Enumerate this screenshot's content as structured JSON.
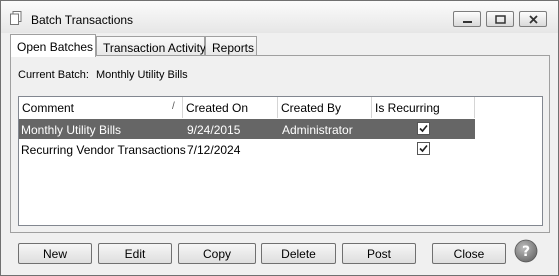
{
  "window": {
    "title": "Batch Transactions"
  },
  "tabs": [
    {
      "label": "Open Batches"
    },
    {
      "label": "Transaction Activity"
    },
    {
      "label": "Reports"
    }
  ],
  "current_batch": {
    "label": "Current Batch:",
    "value": "Monthly Utility Bills"
  },
  "grid": {
    "columns": [
      "Comment",
      "Created On",
      "Created By",
      "Is Recurring"
    ],
    "rows": [
      {
        "comment": "Monthly Utility Bills",
        "created_on": "9/24/2015",
        "created_by": "Administrator",
        "is_recurring": true,
        "selected": true
      },
      {
        "comment": "Recurring Vendor Transactions",
        "created_on": "7/12/2024",
        "created_by": "",
        "is_recurring": true,
        "selected": false
      }
    ]
  },
  "buttons": {
    "new": "New",
    "edit": "Edit",
    "copy": "Copy",
    "delete": "Delete",
    "post": "Post",
    "close": "Close"
  },
  "icons": {
    "help": "help-icon",
    "app": "document-icon"
  },
  "colors": {
    "selected_row": "#666666"
  }
}
